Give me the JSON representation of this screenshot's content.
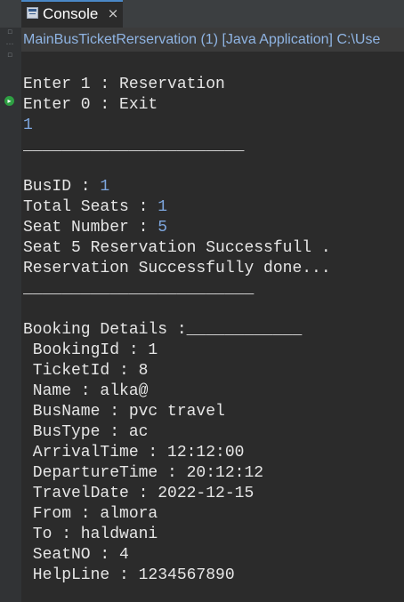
{
  "tab": {
    "title": "Console",
    "close_glyph": "×",
    "icon": "console-icon"
  },
  "launch": {
    "text": "MainBusTicketRerservation (1) [Java Application] C:\\Use"
  },
  "console": {
    "lines": [
      {
        "text": "Enter 1 : Reservation"
      },
      {
        "text": "Enter 0 : Exit"
      },
      {
        "text": "",
        "input": "1"
      },
      {
        "text": "_______________________"
      },
      {
        "text": ""
      },
      {
        "text": "BusID : ",
        "input": "1"
      },
      {
        "text": "Total Seats : ",
        "input": "1"
      },
      {
        "text": "Seat Number : ",
        "input": "5"
      },
      {
        "text": "Seat 5 Reservation Successfull ."
      },
      {
        "text": "Reservation Successfully done..."
      },
      {
        "text": "________________________"
      },
      {
        "text": ""
      },
      {
        "text": "Booking Details :____________"
      },
      {
        "text": " BookingId : 1"
      },
      {
        "text": " TicketId : 8"
      },
      {
        "text": " Name : alka@"
      },
      {
        "text": " BusName : pvc travel"
      },
      {
        "text": " BusType : ac"
      },
      {
        "text": " ArrivalTime : 12:12:00"
      },
      {
        "text": " DepartureTime : 20:12:12"
      },
      {
        "text": " TravelDate : 2022-12-15"
      },
      {
        "text": " From : almora"
      },
      {
        "text": " To : haldwani"
      },
      {
        "text": " SeatNO : 4"
      },
      {
        "text": " HelpLine : 1234567890"
      }
    ]
  },
  "colors": {
    "background": "#2b2b2b",
    "text": "#e6e6e6",
    "input": "#7ea7df",
    "launch_text": "#8fb4e3"
  }
}
